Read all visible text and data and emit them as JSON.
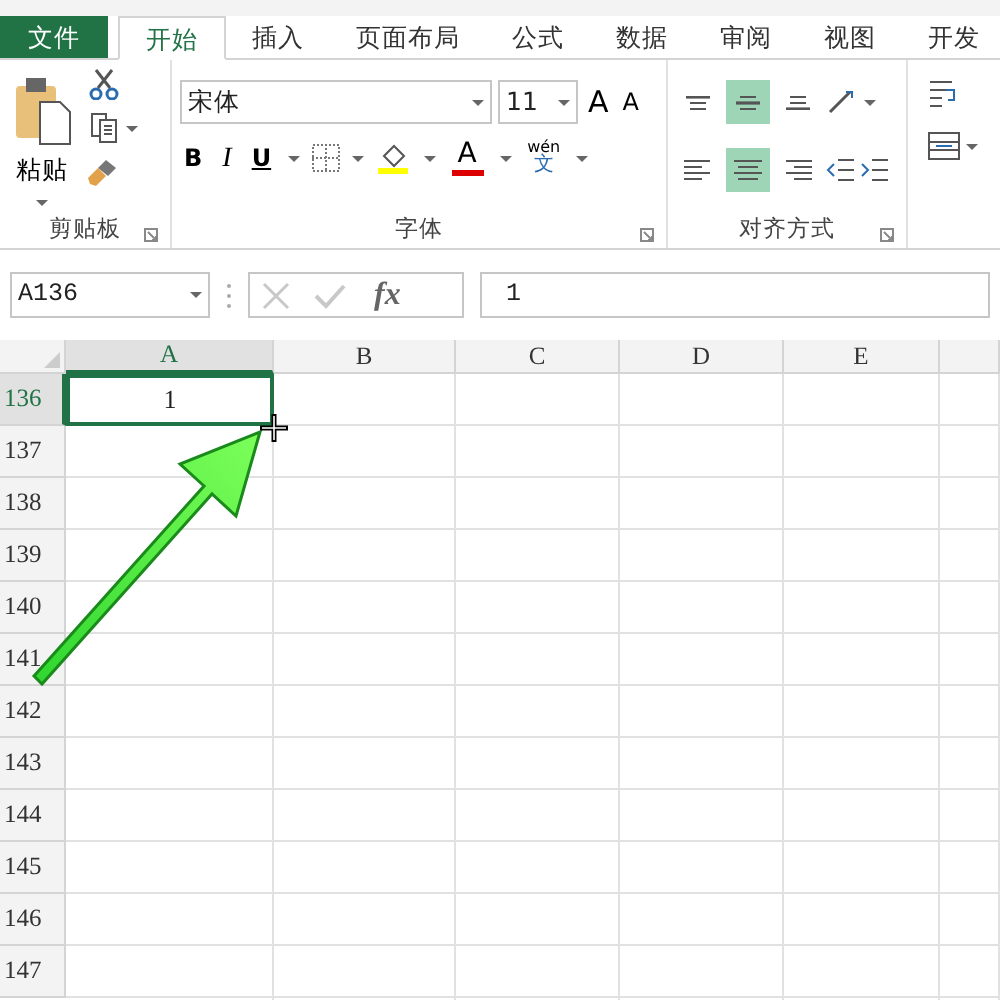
{
  "tabs": [
    {
      "label": "文件",
      "kind": "file",
      "selected": false
    },
    {
      "label": "开始",
      "kind": "tab",
      "selected": true
    },
    {
      "label": "插入",
      "kind": "tab",
      "selected": false
    },
    {
      "label": "页面布局",
      "kind": "tab",
      "selected": false
    },
    {
      "label": "公式",
      "kind": "tab",
      "selected": false
    },
    {
      "label": "数据",
      "kind": "tab",
      "selected": false
    },
    {
      "label": "审阅",
      "kind": "tab",
      "selected": false
    },
    {
      "label": "视图",
      "kind": "tab",
      "selected": false
    },
    {
      "label": "开发",
      "kind": "tab",
      "selected": false
    }
  ],
  "ribbon": {
    "clipboard": {
      "paste_label": "粘贴",
      "group_label": "剪贴板"
    },
    "font": {
      "font_name": "宋体",
      "font_size": "11",
      "grow_label": "A",
      "shrink_label": "A",
      "bold": "B",
      "italic": "I",
      "underline": "U",
      "font_color_label": "A",
      "phonetic_top": "wén",
      "phonetic_bottom": "文",
      "group_label": "字体"
    },
    "alignment": {
      "group_label": "对齐方式",
      "vertical": [
        {
          "kind": "top",
          "selected": false
        },
        {
          "kind": "middle",
          "selected": true
        },
        {
          "kind": "bottom",
          "selected": false
        }
      ],
      "horizontal": [
        {
          "kind": "left",
          "selected": false
        },
        {
          "kind": "center",
          "selected": true
        },
        {
          "kind": "right",
          "selected": false
        }
      ]
    }
  },
  "formula_bar": {
    "name_box": "A136",
    "fx": "fx",
    "value": "1"
  },
  "sheet": {
    "columns": [
      {
        "label": "A",
        "selected": true
      },
      {
        "label": "B",
        "selected": false
      },
      {
        "label": "C",
        "selected": false
      },
      {
        "label": "D",
        "selected": false
      },
      {
        "label": "E",
        "selected": false
      }
    ],
    "rows": [
      {
        "label": "136",
        "selected": true,
        "cells": [
          "1"
        ]
      },
      {
        "label": "137",
        "selected": false,
        "cells": []
      },
      {
        "label": "138",
        "selected": false,
        "cells": []
      },
      {
        "label": "139",
        "selected": false,
        "cells": []
      },
      {
        "label": "140",
        "selected": false,
        "cells": []
      },
      {
        "label": "141",
        "selected": false,
        "cells": []
      },
      {
        "label": "142",
        "selected": false,
        "cells": []
      },
      {
        "label": "143",
        "selected": false,
        "cells": []
      },
      {
        "label": "144",
        "selected": false,
        "cells": []
      },
      {
        "label": "145",
        "selected": false,
        "cells": []
      },
      {
        "label": "146",
        "selected": false,
        "cells": []
      },
      {
        "label": "147",
        "selected": false,
        "cells": []
      }
    ]
  }
}
